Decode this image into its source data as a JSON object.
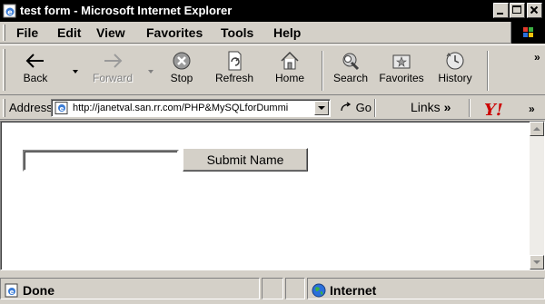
{
  "window": {
    "title": "test form - Microsoft Internet Explorer"
  },
  "menu": {
    "items": [
      {
        "label": "File"
      },
      {
        "label": "Edit"
      },
      {
        "label": "View"
      },
      {
        "label": "Favorites"
      },
      {
        "label": "Tools"
      },
      {
        "label": "Help"
      }
    ]
  },
  "toolbar": {
    "buttons": [
      {
        "label": "Back",
        "icon": "back-arrow-icon",
        "enabled": true
      },
      {
        "label": "Forward",
        "icon": "forward-arrow-icon",
        "enabled": false
      },
      {
        "label": "Stop",
        "icon": "stop-icon",
        "enabled": true
      },
      {
        "label": "Refresh",
        "icon": "refresh-icon",
        "enabled": true
      },
      {
        "label": "Home",
        "icon": "home-icon",
        "enabled": true
      },
      {
        "label": "Search",
        "icon": "search-icon",
        "enabled": true
      },
      {
        "label": "Favorites",
        "icon": "favorites-icon",
        "enabled": true
      },
      {
        "label": "History",
        "icon": "history-icon",
        "enabled": true
      }
    ],
    "overflow": "»"
  },
  "address": {
    "label": "Address",
    "url": "http://janetval.san.rr.com/PHP&MySQLforDummi",
    "go_label": "Go",
    "links_label": "Links",
    "links_chevron": "»",
    "yahoo_text": "Y!",
    "overflow": "»"
  },
  "form": {
    "name_value": "",
    "submit_label": "Submit Name"
  },
  "status": {
    "text": "Done",
    "zone": "Internet"
  },
  "colors": {
    "chrome": "#d4d0c8",
    "titlebar": "#000000",
    "yahoo_red": "#cc0000"
  }
}
